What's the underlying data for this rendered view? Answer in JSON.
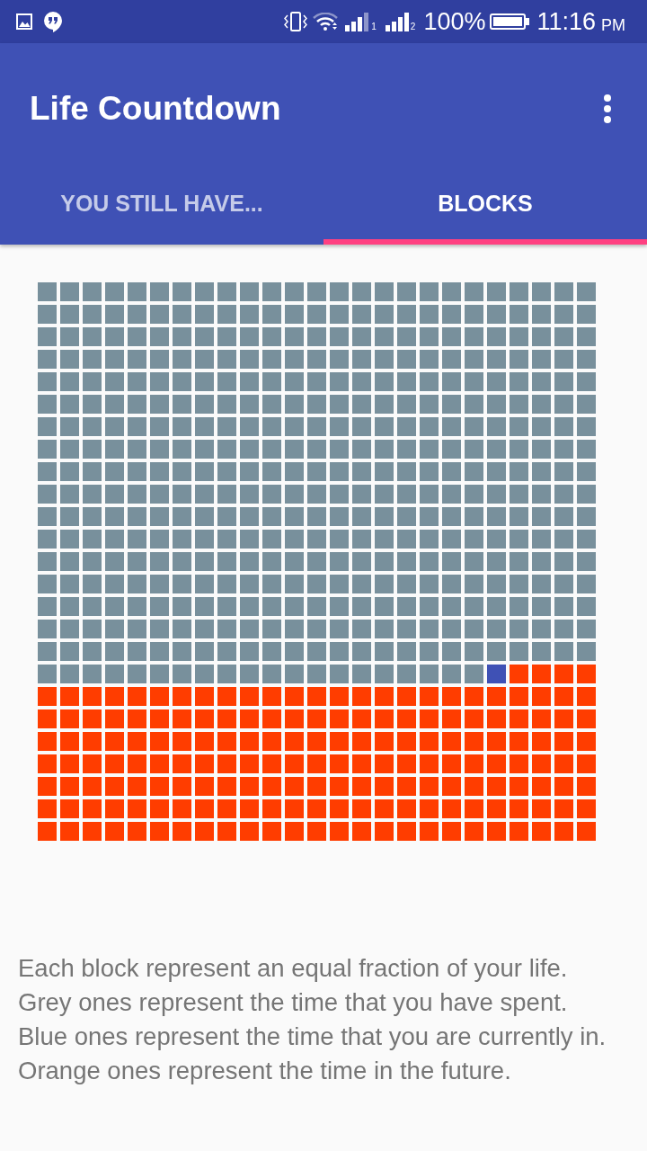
{
  "status_bar": {
    "sim_labels": [
      "1",
      "2"
    ],
    "battery": "100%",
    "time": "11:16",
    "period": "PM"
  },
  "app_bar": {
    "title": "Life Countdown"
  },
  "tabs": [
    {
      "label": "YOU STILL HAVE...",
      "selected": false
    },
    {
      "label": "BLOCKS",
      "selected": true
    }
  ],
  "life_grid": {
    "level": 0.712
  },
  "legend": [
    "Each block represent an equal fraction of your life.",
    "Grey ones represent the time that you have spent.",
    "Blue ones represent the time that you are currently in.",
    "Orange ones represent the time in the future."
  ]
}
